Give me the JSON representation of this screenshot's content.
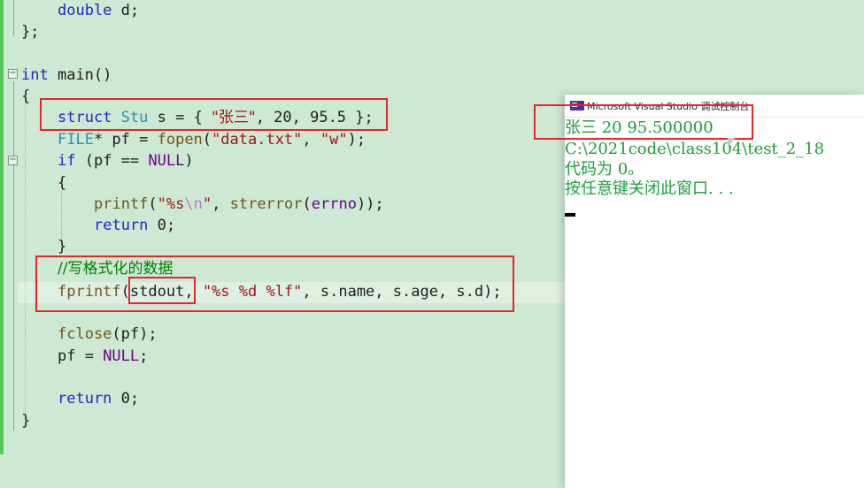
{
  "editor": {
    "lines": {
      "double_kw": "double",
      "double_rest": " d;",
      "struct_close": "};",
      "main_kw": "int",
      "main_rest": " main()",
      "brace_open": "{",
      "s1_kw": "struct",
      "s1_type": "Stu",
      "s1_mid": " s = { ",
      "s1_str": "\"张三\"",
      "s1_rest": ", 20, 95.5 };",
      "s2_type": "FILE",
      "s2_mid": "* pf = ",
      "s2_fn": "fopen",
      "s2_open": "(",
      "s2_str1": "\"data.txt\"",
      "s2_comma": ", ",
      "s2_str2": "\"w\"",
      "s2_end": ");",
      "s3_kw": "if",
      "s3_mid": " (pf == ",
      "s3_macro": "NULL",
      "s3_end": ")",
      "s4": "{",
      "s5_fn": "printf",
      "s5_open": "(",
      "s5_str_a": "\"%s",
      "s5_esc": "\\n",
      "s5_str_b": "\"",
      "s5_mid": ", ",
      "s5_fn2": "strerror",
      "s5_arg": "(",
      "s5_macro": "errno",
      "s5_end": "));",
      "s6_kw": "return",
      "s6_rest": " 0;",
      "s7": "}",
      "comment": "//写格式化的数据",
      "s8_fn": "fprintf",
      "s8_open": "(",
      "s8_stdout": "stdout",
      "s8_comma": ", ",
      "s8_str": "\"%s %d %lf\"",
      "s8_rest": ", s.name, s.age, s.d);",
      "s9_fn": "fclose",
      "s9_rest": "(pf);",
      "s10_mid": "pf = ",
      "s10_macro": "NULL",
      "s10_end": ";",
      "s11_kw": "return",
      "s11_rest": " 0;",
      "brace_close": "}"
    },
    "fold_collapse_glyph": "−"
  },
  "console": {
    "title": "Microsoft Visual Studio 调试控制台",
    "output": [
      "张三 20 95.500000",
      "C:\\2021code\\class104\\test_2_18",
      "代码为 0。",
      "按任意键关闭此窗口. . ."
    ]
  },
  "colors": {
    "editor_bg": "#cde8d3",
    "keyword": "#1f28c8",
    "type": "#2b91af",
    "string": "#a31515",
    "comment": "#008000",
    "annotation_box": "#e5262b",
    "console_text": "#1f9a3a"
  }
}
